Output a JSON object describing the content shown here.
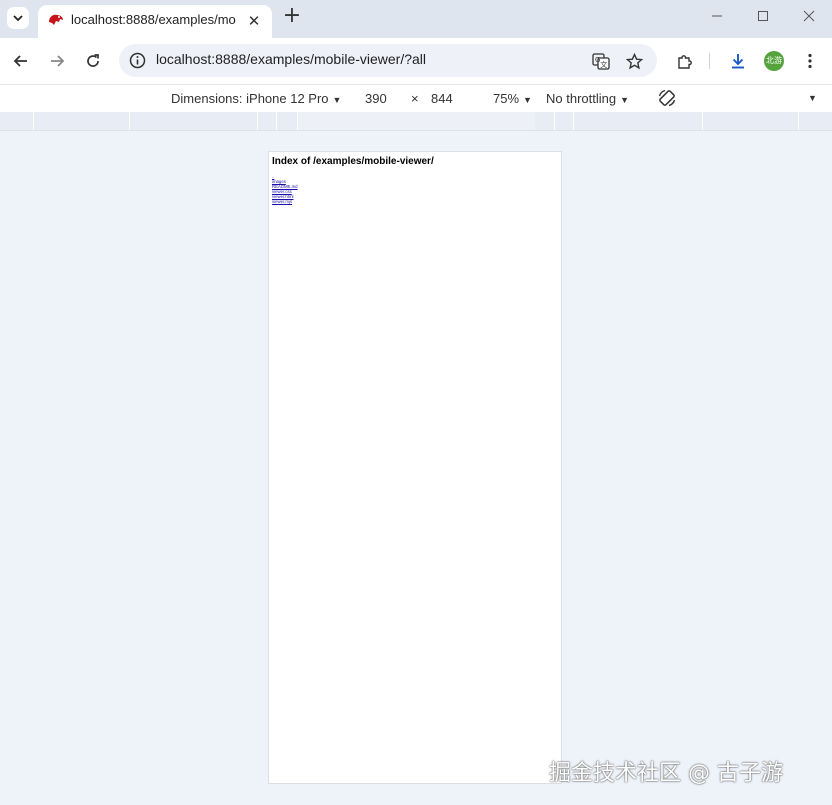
{
  "browser": {
    "tab": {
      "title": "localhost:8888/examples/mo"
    },
    "omnibox": {
      "url": "localhost:8888/examples/mobile-viewer/?all"
    },
    "profile": {
      "avatar_text": "北游",
      "color": "#54a33c"
    }
  },
  "devtools": {
    "dimensions_label": "Dimensions: iPhone 12 Pro",
    "width": "390",
    "times": "×",
    "height": "844",
    "zoom": "75%",
    "throttling": "No throttling"
  },
  "page": {
    "heading": "Index of /examples/mobile-viewer/",
    "entries": [
      {
        "name": ".."
      },
      {
        "name": "images"
      },
      {
        "name": "README.md"
      },
      {
        "name": "viewer.css"
      },
      {
        "name": "viewer.html"
      },
      {
        "name": "viewer.mjs"
      }
    ]
  },
  "watermark": {
    "text": "掘金技术社区 @ 古子游"
  },
  "icons": {
    "tab_search": "chevron-down-icon",
    "favicon": "animal-logo-icon",
    "back": "arrow-left-icon",
    "forward": "arrow-right-icon",
    "reload": "reload-icon",
    "site_info": "info-icon",
    "translate": "translate-icon",
    "bookmark": "star-icon",
    "extensions": "puzzle-icon",
    "download": "download-icon",
    "menu": "kebab-menu-icon",
    "rotate": "rotate-icon"
  }
}
